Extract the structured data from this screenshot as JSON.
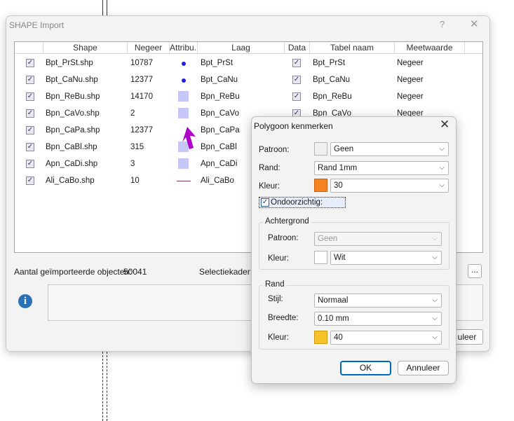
{
  "main_window": {
    "title": "SHAPE Import",
    "help_glyph": "?",
    "close_glyph": "✕",
    "columns": [
      "Shape",
      "Negeer",
      "Attribu...",
      "Laag",
      "Data",
      "Tabel naam",
      "Meetwaarde"
    ],
    "rows": [
      {
        "shape": "Bpt_PrSt.shp",
        "negeer": "10787",
        "symbol": "point",
        "laag": "Bpt_PrSt",
        "tabel": "Bpt_PrSt",
        "meetwaarde": "Negeer"
      },
      {
        "shape": "Bpt_CaNu.shp",
        "negeer": "12377",
        "symbol": "point",
        "laag": "Bpt_CaNu",
        "tabel": "Bpt_CaNu",
        "meetwaarde": "Negeer"
      },
      {
        "shape": "Bpn_ReBu.shp",
        "negeer": "14170",
        "symbol": "polygon",
        "laag": "Bpn_ReBu",
        "tabel": "Bpn_ReBu",
        "meetwaarde": "Negeer"
      },
      {
        "shape": "Bpn_CaVo.shp",
        "negeer": "2",
        "symbol": "polygon",
        "laag": "Bpn_CaVo",
        "tabel": "Bpn_CaVo",
        "meetwaarde": "Negeer"
      },
      {
        "shape": "Bpn_CaPa.shp",
        "negeer": "12377",
        "symbol": "none",
        "laag": "Bpn_CaPa",
        "tabel": "",
        "meetwaarde": ""
      },
      {
        "shape": "Bpn_CaBl.shp",
        "negeer": "315",
        "symbol": "polygon",
        "laag": "Bpn_CaBl",
        "tabel": "",
        "meetwaarde": ""
      },
      {
        "shape": "Apn_CaDi.shp",
        "negeer": "3",
        "symbol": "polygon",
        "laag": "Apn_CaDi",
        "tabel": "",
        "meetwaarde": ""
      },
      {
        "shape": "Ali_CaBo.shp",
        "negeer": "10",
        "symbol": "line",
        "laag": "Ali_CaBo",
        "tabel": "",
        "meetwaarde": ""
      }
    ],
    "imported_label": "Aantal geïmporteerde objecten:",
    "imported_count": "50041",
    "selection_label": "Selectiekader:",
    "more_button": "...",
    "cancel_partial": "uleer",
    "info_glyph": "i",
    "check_glyph": "✓"
  },
  "polygon_dialog": {
    "title": "Polygoon kenmerken",
    "close_glyph": "✕",
    "patroon_label": "Patroon:",
    "patroon_value": "Geen",
    "rand_label": "Rand:",
    "rand_value": "Rand 1mm",
    "kleur_label": "Kleur:",
    "kleur_value": "30",
    "kleur_color": "#f58220",
    "opaque_label": "Ondoorzichtig:",
    "achtergrond": {
      "title": "Achtergrond",
      "patroon_label": "Patroon:",
      "patroon_value": "Geen",
      "kleur_label": "Kleur:",
      "kleur_value": "Wit",
      "kleur_color": "#ffffff"
    },
    "rand_group": {
      "title": "Rand",
      "stijl_label": "Stijl:",
      "stijl_value": "Normaal",
      "breedte_label": "Breedte:",
      "breedte_value": "0.10 mm",
      "kleur_label": "Kleur:",
      "kleur_value": "40",
      "kleur_color": "#f8c32a"
    },
    "ok_label": "OK",
    "cancel_label": "Annuleer",
    "chevron_glyph": "⌵"
  },
  "colors": {
    "cursor": "#b000c8",
    "point_symbol": "#1f1fe0",
    "polygon_symbol": "#c6c6f7",
    "line_symbol": "#8a3a55",
    "focus_blue": "#0067c0"
  }
}
